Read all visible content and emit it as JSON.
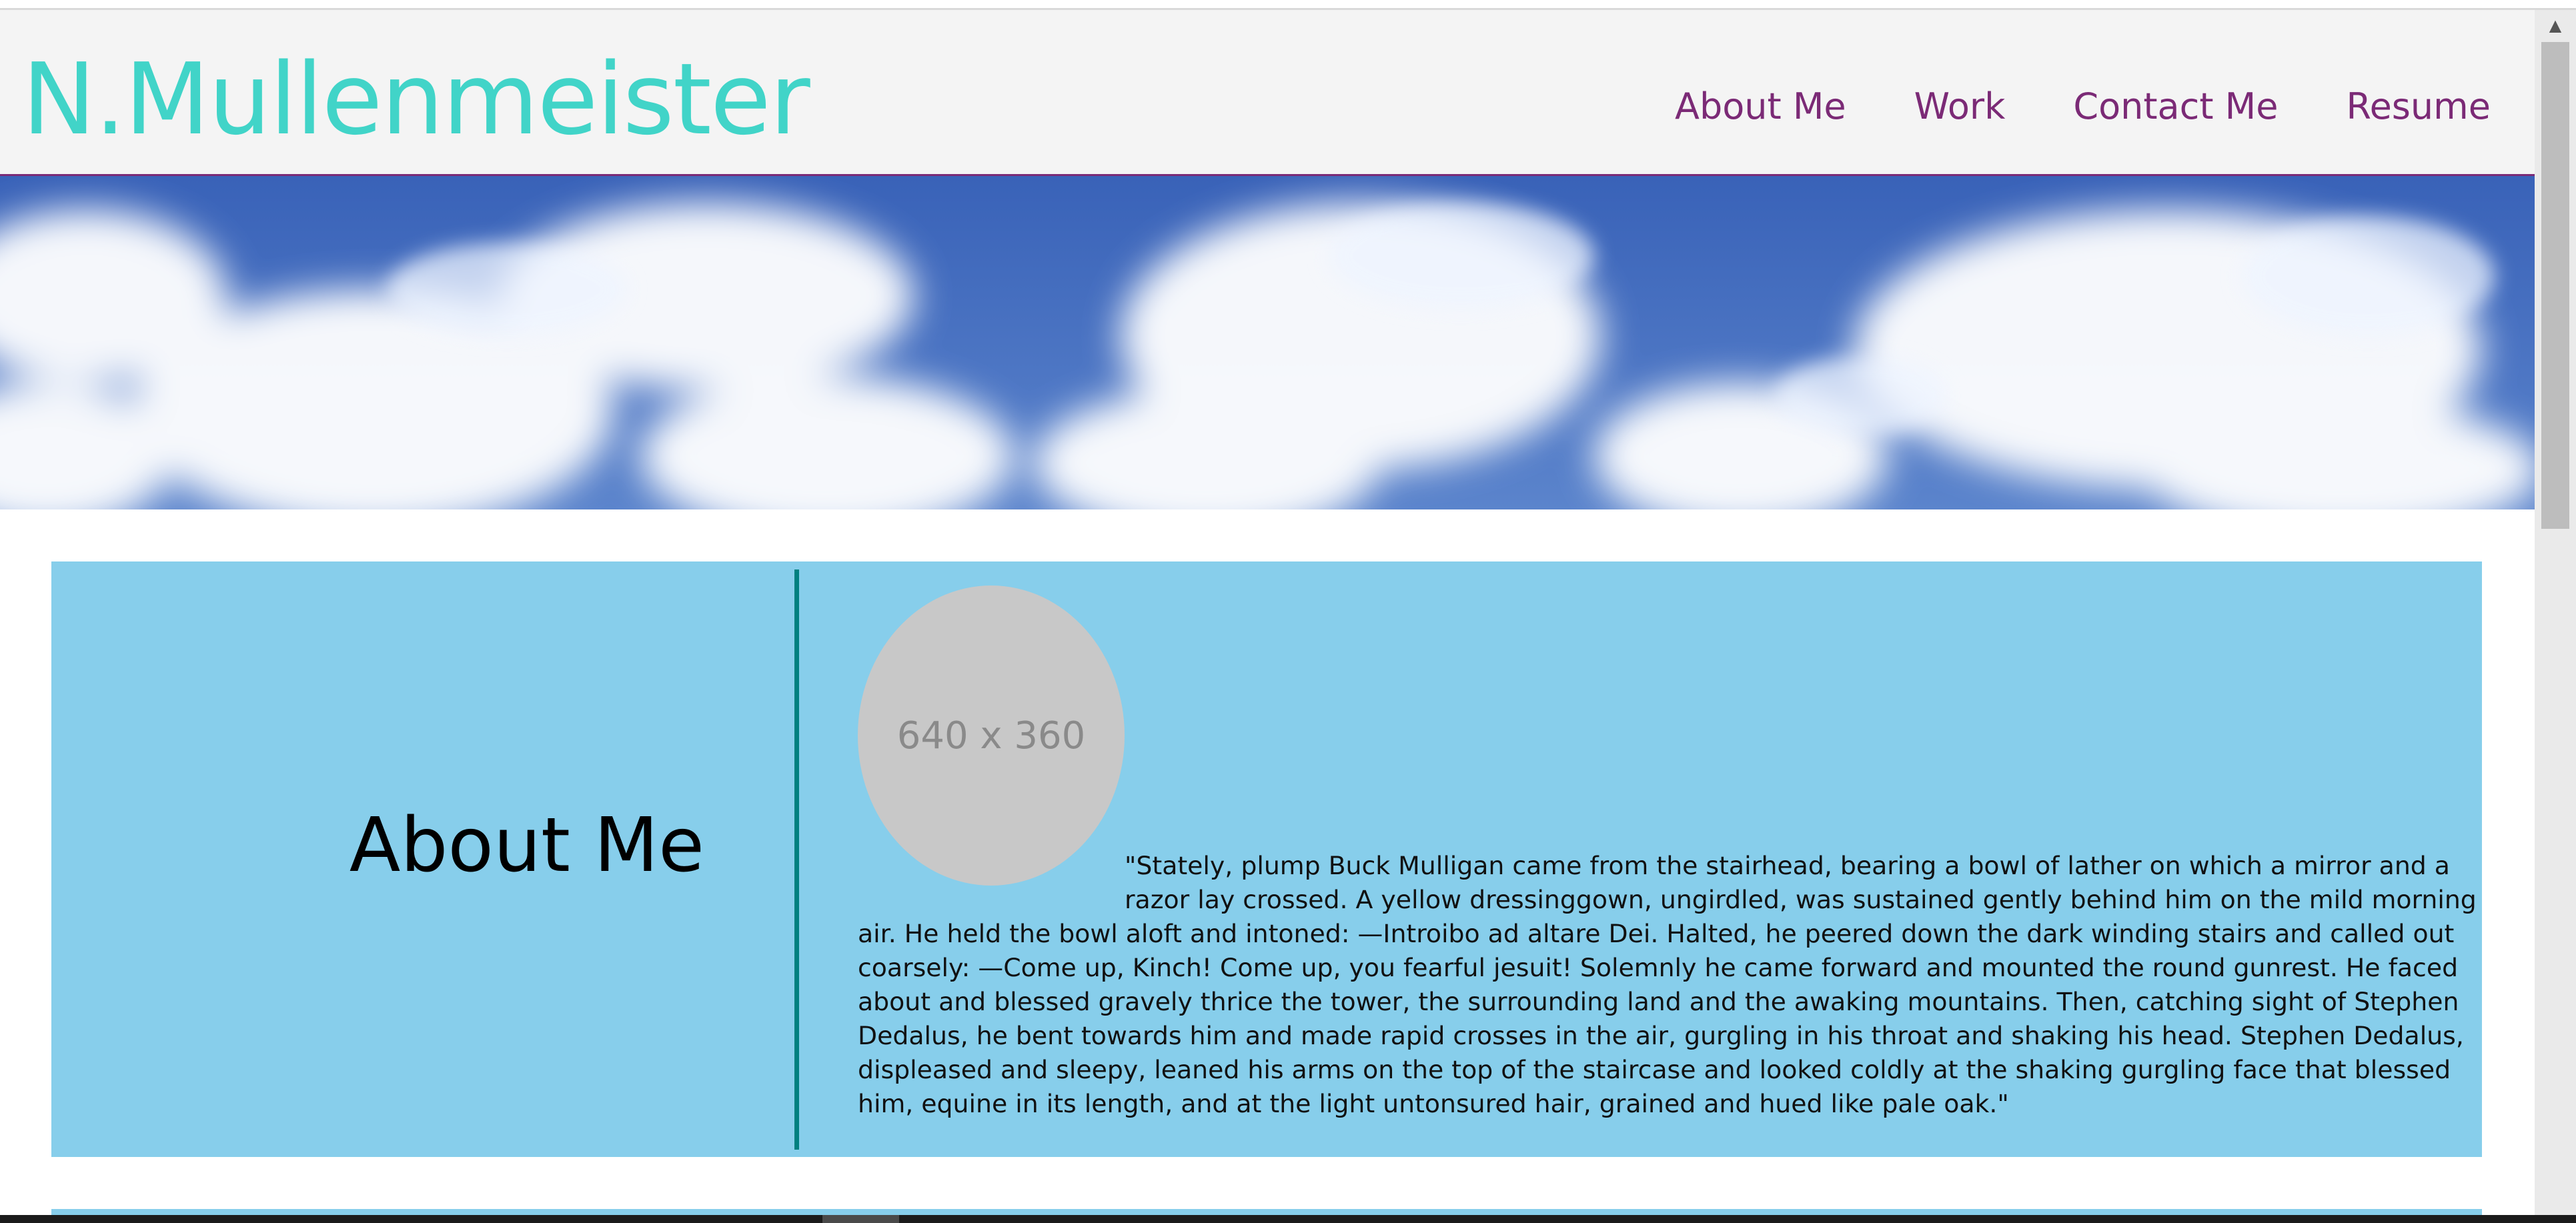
{
  "site": {
    "brand": "N.Mullenmeister",
    "nav": [
      "About Me",
      "Work",
      "Contact Me",
      "Resume"
    ],
    "colors": {
      "header_bg": "#f4f4f4",
      "brand": "#41d4c8",
      "nav": "#7b2a76",
      "section_bg": "#87ceeb",
      "divider": "#008080"
    }
  },
  "hero": {
    "image": "sky-with-clouds"
  },
  "about": {
    "title": "About Me",
    "placeholder": "640 x 360",
    "quote": "\"Stately, plump Buck Mulligan came from the stairhead, bearing a bowl of lather on which a mirror and a razor lay crossed. A yellow dressinggown, ungirdled, was sustained gently behind him on the mild morning air. He held the bowl aloft and intoned: —Introibo ad altare Dei. Halted, he peered down the dark winding stairs and called out coarsely: —Come up, Kinch! Come up, you fearful jesuit! Solemnly he came forward and mounted the round gunrest. He faced about and blessed gravely thrice the tower, the surrounding land and the awaking mountains. Then, catching sight of Stephen Dedalus, he bent towards him and made rapid crosses in the air, gurgling in his throat and shaking his head. Stephen Dedalus, displeased and sleepy, leaned his arms on the top of the staircase and looked coldly at the shaking gurgling face that blessed him, equine in its length, and at the light untonsured hair, grained and hued like pale oak.\""
  }
}
